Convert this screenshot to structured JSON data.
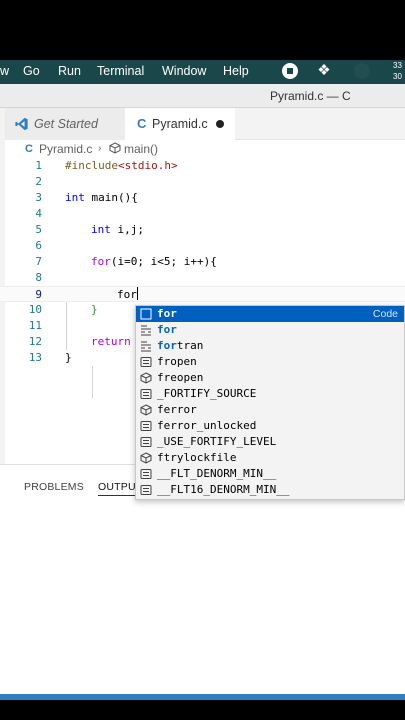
{
  "menubar": {
    "items": [
      "w",
      "Go",
      "Run",
      "Terminal",
      "Window",
      "Help"
    ],
    "clock": [
      "33",
      "30"
    ],
    "tray_icons": [
      "stop-icon",
      "dropbox-icon",
      "status-dim-icon"
    ]
  },
  "window": {
    "title": "Pyramid.c — C"
  },
  "tabs": [
    {
      "label": "Get Started",
      "icon": "vscode-icon"
    },
    {
      "label": "Pyramid.c",
      "icon": "c-file-icon",
      "dirty": true
    }
  ],
  "tab_c_glyph": "C",
  "breadcrumb": {
    "file": "Pyramid.c",
    "glyph": "C",
    "separator": "›",
    "symbol": "main()"
  },
  "code_lines": [
    {
      "n": "1",
      "text": "#include<stdio.h>"
    },
    {
      "n": "2",
      "text": ""
    },
    {
      "n": "3",
      "text": "int main(){"
    },
    {
      "n": "4",
      "text": ""
    },
    {
      "n": "5",
      "text": "int i,j;"
    },
    {
      "n": "6",
      "text": ""
    },
    {
      "n": "7",
      "text": "for(i=0; i<5; i++){"
    },
    {
      "n": "8",
      "text": ""
    },
    {
      "n": "9",
      "text": "for"
    },
    {
      "n": "10",
      "text": "}"
    },
    {
      "n": "11",
      "text": ""
    },
    {
      "n": "12",
      "text": "return"
    },
    {
      "n": "13",
      "text": "}"
    }
  ],
  "code_tokens": {
    "include": "#include",
    "header": "<stdio.h>",
    "int": "int",
    "main": " main(){",
    "decl": " i,j;",
    "for": "for",
    "loop": "(i=0; i<5; i++){",
    "typed": "for",
    "close": "}",
    "return": "return"
  },
  "panel": {
    "tabs": [
      "PROBLEMS",
      "OUTPUT"
    ]
  },
  "suggestions": [
    {
      "label": "for",
      "match": "for",
      "rest": "",
      "icon": "snippet-icon",
      "detail": "Code",
      "selected": true
    },
    {
      "label": "for",
      "match": "for",
      "rest": "",
      "icon": "keyword-icon"
    },
    {
      "label": "fortran",
      "match": "for",
      "rest": "tran",
      "icon": "keyword-icon"
    },
    {
      "label": "fropen",
      "pre": "",
      "icon": "snippet-icon"
    },
    {
      "label": "freopen",
      "icon": "cube-icon"
    },
    {
      "label": "_FORTIFY_SOURCE",
      "icon": "snippet-icon"
    },
    {
      "label": "ferror",
      "icon": "cube-icon"
    },
    {
      "label": "ferror_unlocked",
      "icon": "snippet-icon"
    },
    {
      "label": "_USE_FORTIFY_LEVEL",
      "icon": "snippet-icon"
    },
    {
      "label": "ftrylockfile",
      "icon": "cube-icon"
    },
    {
      "label": "__FLT_DENORM_MIN__",
      "icon": "snippet-icon"
    },
    {
      "label": "__FLT16_DENORM_MIN__",
      "icon": "snippet-icon"
    }
  ]
}
